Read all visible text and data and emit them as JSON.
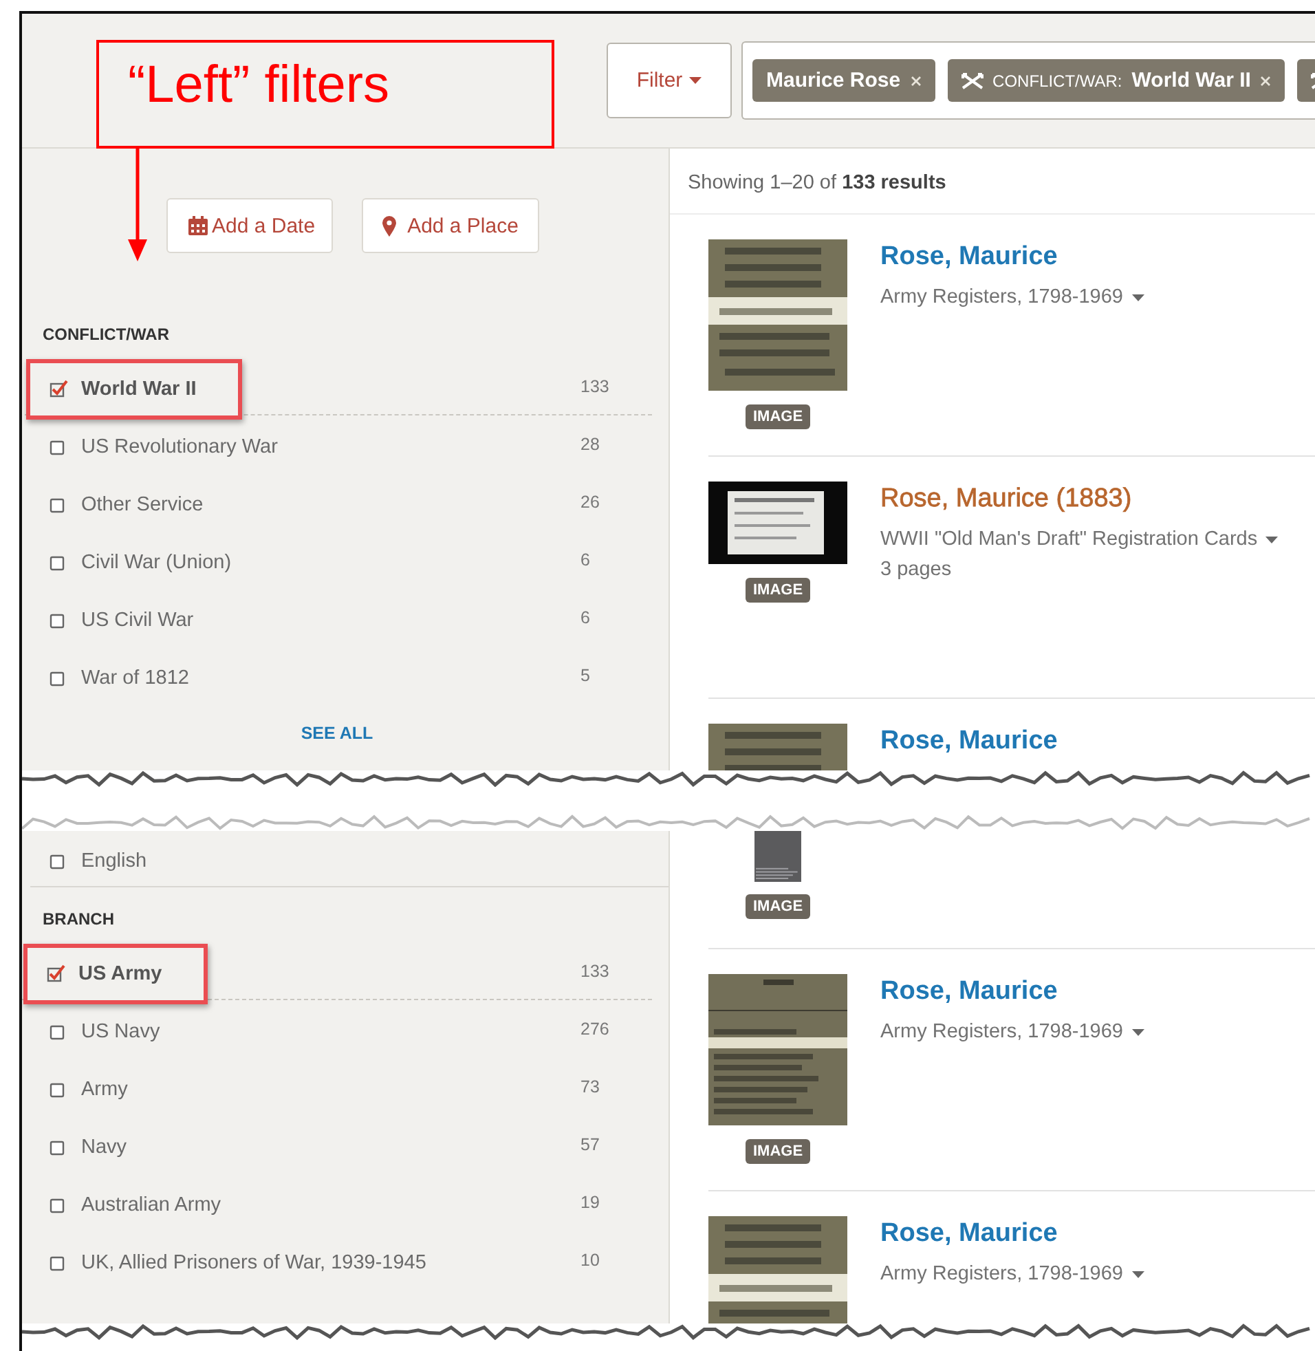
{
  "header": {
    "filter_button": "Filter",
    "chips": [
      {
        "kind": "term",
        "value": "Maurice Rose"
      },
      {
        "kind": "category",
        "prefix": "CONFLICT/WAR:",
        "value": "World War II"
      },
      {
        "kind": "partial"
      }
    ]
  },
  "annotation": {
    "text": "“Left” filters"
  },
  "sidebar_top": {
    "buttons": [
      {
        "kind": "date",
        "label": "Add a Date"
      },
      {
        "kind": "place",
        "label": "Add a Place"
      }
    ],
    "facets": [
      {
        "title": "CONFLICT/WAR",
        "see_all": "SEE ALL",
        "items": [
          {
            "label": "World War II",
            "count": "133",
            "checked": true,
            "highlighted": true
          },
          {
            "label": "US Revolutionary War",
            "count": "28",
            "checked": false,
            "highlighted": false
          },
          {
            "label": "Other Service",
            "count": "26",
            "checked": false,
            "highlighted": false
          },
          {
            "label": "Civil War (Union)",
            "count": "6",
            "checked": false,
            "highlighted": false
          },
          {
            "label": "US Civil War",
            "count": "6",
            "checked": false,
            "highlighted": false
          },
          {
            "label": "War of 1812",
            "count": "5",
            "checked": false,
            "highlighted": false
          }
        ]
      }
    ]
  },
  "sidebar_bottom": {
    "facets": [
      {
        "items": [
          {
            "label": "English",
            "checked": false,
            "highlighted": false
          }
        ]
      },
      {
        "title": "BRANCH",
        "items": [
          {
            "label": "US Army",
            "count": "133",
            "checked": true,
            "highlighted": true
          },
          {
            "label": "US Navy",
            "count": "276",
            "checked": false,
            "highlighted": false
          },
          {
            "label": "Army",
            "count": "73",
            "checked": false,
            "highlighted": false
          },
          {
            "label": "Navy",
            "count": "57",
            "checked": false,
            "highlighted": false
          },
          {
            "label": "Australian Army",
            "count": "19",
            "checked": false,
            "highlighted": false
          },
          {
            "label": "UK, Allied Prisoners of War, 1939-1945",
            "count": "10",
            "checked": false,
            "highlighted": false
          }
        ]
      }
    ]
  },
  "results_top": {
    "summary": "Showing 1–20 of **133 results**",
    "items": [
      {
        "badge": "IMAGE",
        "title": "Rose, Maurice",
        "visited": false,
        "collection": "Army Registers, 1798-1969"
      },
      {
        "badge": "IMAGE",
        "title": "Rose, Maurice (1883)",
        "visited": true,
        "collection": "WWII \"Old Man's Draft\" Registration Cards",
        "pages": "3 pages"
      },
      {
        "title": "Rose, Maurice",
        "visited": false
      }
    ]
  },
  "results_bottom": {
    "items": [
      {
        "badge": "IMAGE"
      },
      {
        "badge": "IMAGE",
        "title": "Rose, Maurice",
        "visited": false,
        "collection": "Army Registers, 1798-1969"
      },
      {
        "title": "Rose, Maurice",
        "visited": false,
        "collection": "Army Registers, 1798-1969"
      }
    ]
  }
}
